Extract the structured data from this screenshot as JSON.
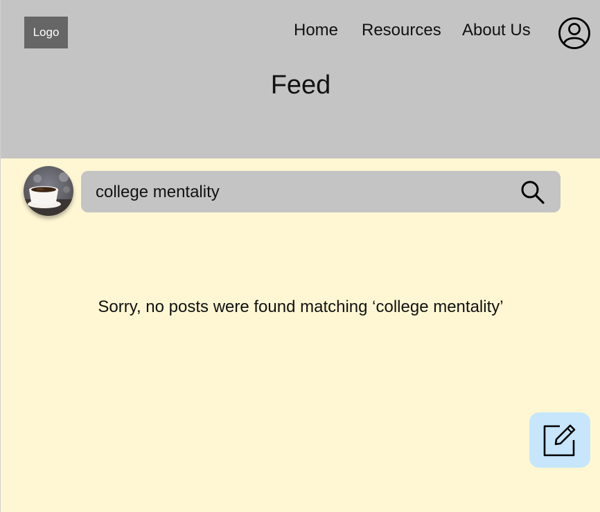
{
  "header": {
    "logo_label": "Logo",
    "nav": [
      "Home",
      "Resources",
      "About Us"
    ],
    "profile_icon": "user-circle-icon",
    "title": "Feed"
  },
  "search": {
    "value": "college mentality",
    "icon": "search-icon"
  },
  "results": {
    "empty_message": "Sorry, no posts were found matching ‘college mentality’"
  },
  "compose": {
    "icon": "edit-icon"
  },
  "colors": {
    "header_bg": "#c4c4c4",
    "page_bg": "#fff7d3",
    "logo_bg": "#666666",
    "search_bg": "#c4c4c4",
    "compose_bg": "#c7e6fb"
  }
}
